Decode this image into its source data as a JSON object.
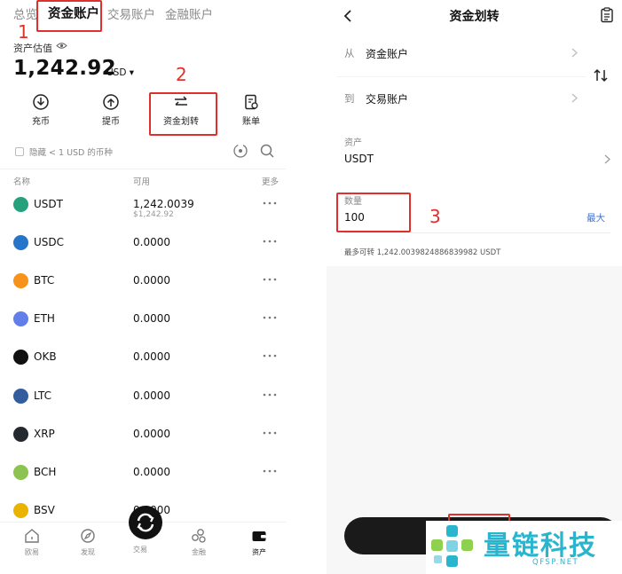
{
  "left_panel": {
    "tabs": [
      {
        "label": "总览"
      },
      {
        "label": "资金账户",
        "active": true
      },
      {
        "label": "交易账户"
      },
      {
        "label": "金融账户"
      }
    ],
    "estimate_label": "资产估值",
    "balance": "1,242.92",
    "currency": "USD ▾",
    "actions": [
      {
        "label": "充币",
        "icon": "deposit-icon"
      },
      {
        "label": "提币",
        "icon": "withdraw-icon"
      },
      {
        "label": "资金划转",
        "icon": "transfer-icon"
      },
      {
        "label": "账单",
        "icon": "bill-icon"
      }
    ],
    "filter_label": "隐藏 < 1 USD 的币种",
    "columns": {
      "name": "名称",
      "available": "可用",
      "more": "更多"
    },
    "assets": [
      {
        "symbol": "USDT",
        "amount": "1,242.0039",
        "sub": "$1,242.92",
        "color": "#26a17b"
      },
      {
        "symbol": "USDC",
        "amount": "0.0000",
        "sub": "",
        "color": "#2775ca"
      },
      {
        "symbol": "BTC",
        "amount": "0.0000",
        "sub": "",
        "color": "#f7931a"
      },
      {
        "symbol": "ETH",
        "amount": "0.0000",
        "sub": "",
        "color": "#627eea"
      },
      {
        "symbol": "OKB",
        "amount": "0.0000",
        "sub": "",
        "color": "#111111"
      },
      {
        "symbol": "LTC",
        "amount": "0.0000",
        "sub": "",
        "color": "#345d9d"
      },
      {
        "symbol": "XRP",
        "amount": "0.0000",
        "sub": "",
        "color": "#23292f"
      },
      {
        "symbol": "BCH",
        "amount": "0.0000",
        "sub": "",
        "color": "#8dc351"
      },
      {
        "symbol": "BSV",
        "amount": "0.0000",
        "sub": "",
        "color": "#eab300"
      }
    ],
    "bottom_nav": [
      {
        "label": "欧易",
        "icon": "home-icon"
      },
      {
        "label": "发现",
        "icon": "discover-icon"
      },
      {
        "label": "交易",
        "icon": "trade-icon"
      },
      {
        "label": "金融",
        "icon": "finance-icon"
      },
      {
        "label": "资产",
        "icon": "wallet-icon",
        "active": true
      }
    ]
  },
  "annotations": {
    "step1": "1",
    "step2": "2",
    "step3": "3",
    "color": "#e0302b"
  },
  "right_panel": {
    "title": "资金划转",
    "from_label": "从",
    "from_value": "资金账户",
    "to_label": "到",
    "to_value": "交易账户",
    "asset_label": "资产",
    "asset_value": "USDT",
    "amount_label": "数量",
    "amount_value": "100",
    "max_label": "最大",
    "available_text": "最多可转 1,242.0039824886839982 USDT"
  },
  "watermark": {
    "text": "量链科技",
    "url": "QFSP.NET",
    "color": "#2ab5cf"
  }
}
